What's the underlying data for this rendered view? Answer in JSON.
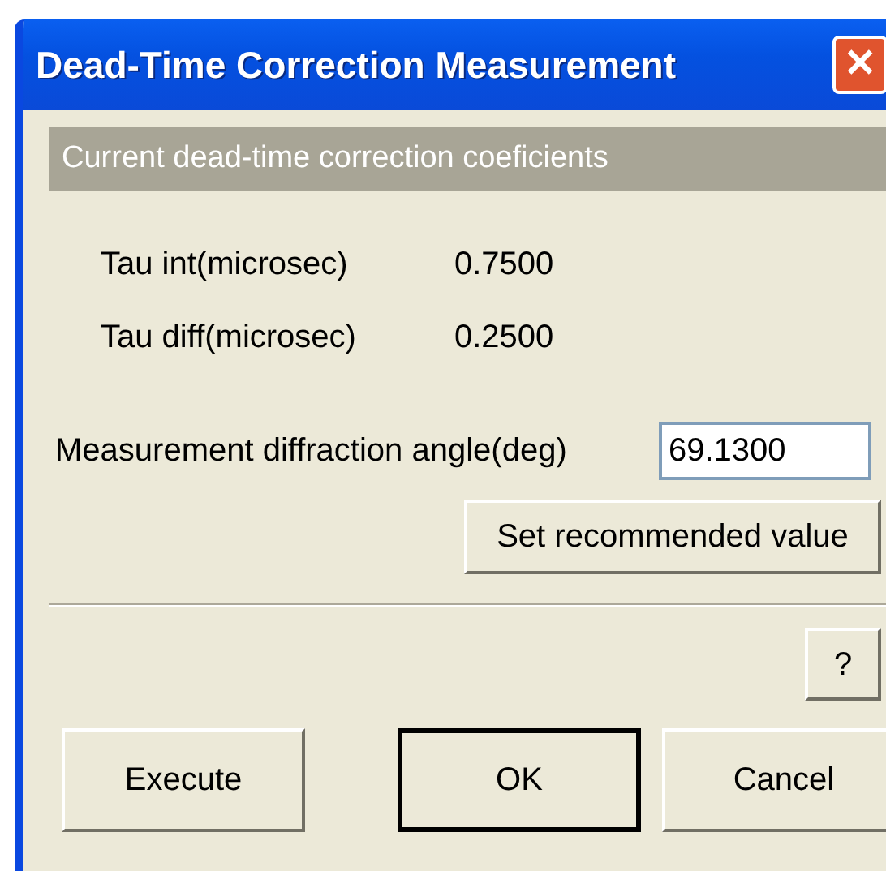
{
  "window": {
    "title": "Dead-Time Correction Measurement",
    "close_label": "✕"
  },
  "group": {
    "title": "Current dead-time correction coeficients",
    "rows": [
      {
        "label": "Tau int(microsec)",
        "value": "0.7500"
      },
      {
        "label": "Tau diff(microsec)",
        "value": "0.2500"
      }
    ]
  },
  "angle_field": {
    "label": "Measurement diffraction angle(deg)",
    "value": "69.1300"
  },
  "recommend_button": "Set recommended value",
  "help_button": "?",
  "buttons": [
    {
      "label": "Execute",
      "default": false
    },
    {
      "label": "OK",
      "default": true
    },
    {
      "label": "Cancel",
      "default": false
    }
  ]
}
